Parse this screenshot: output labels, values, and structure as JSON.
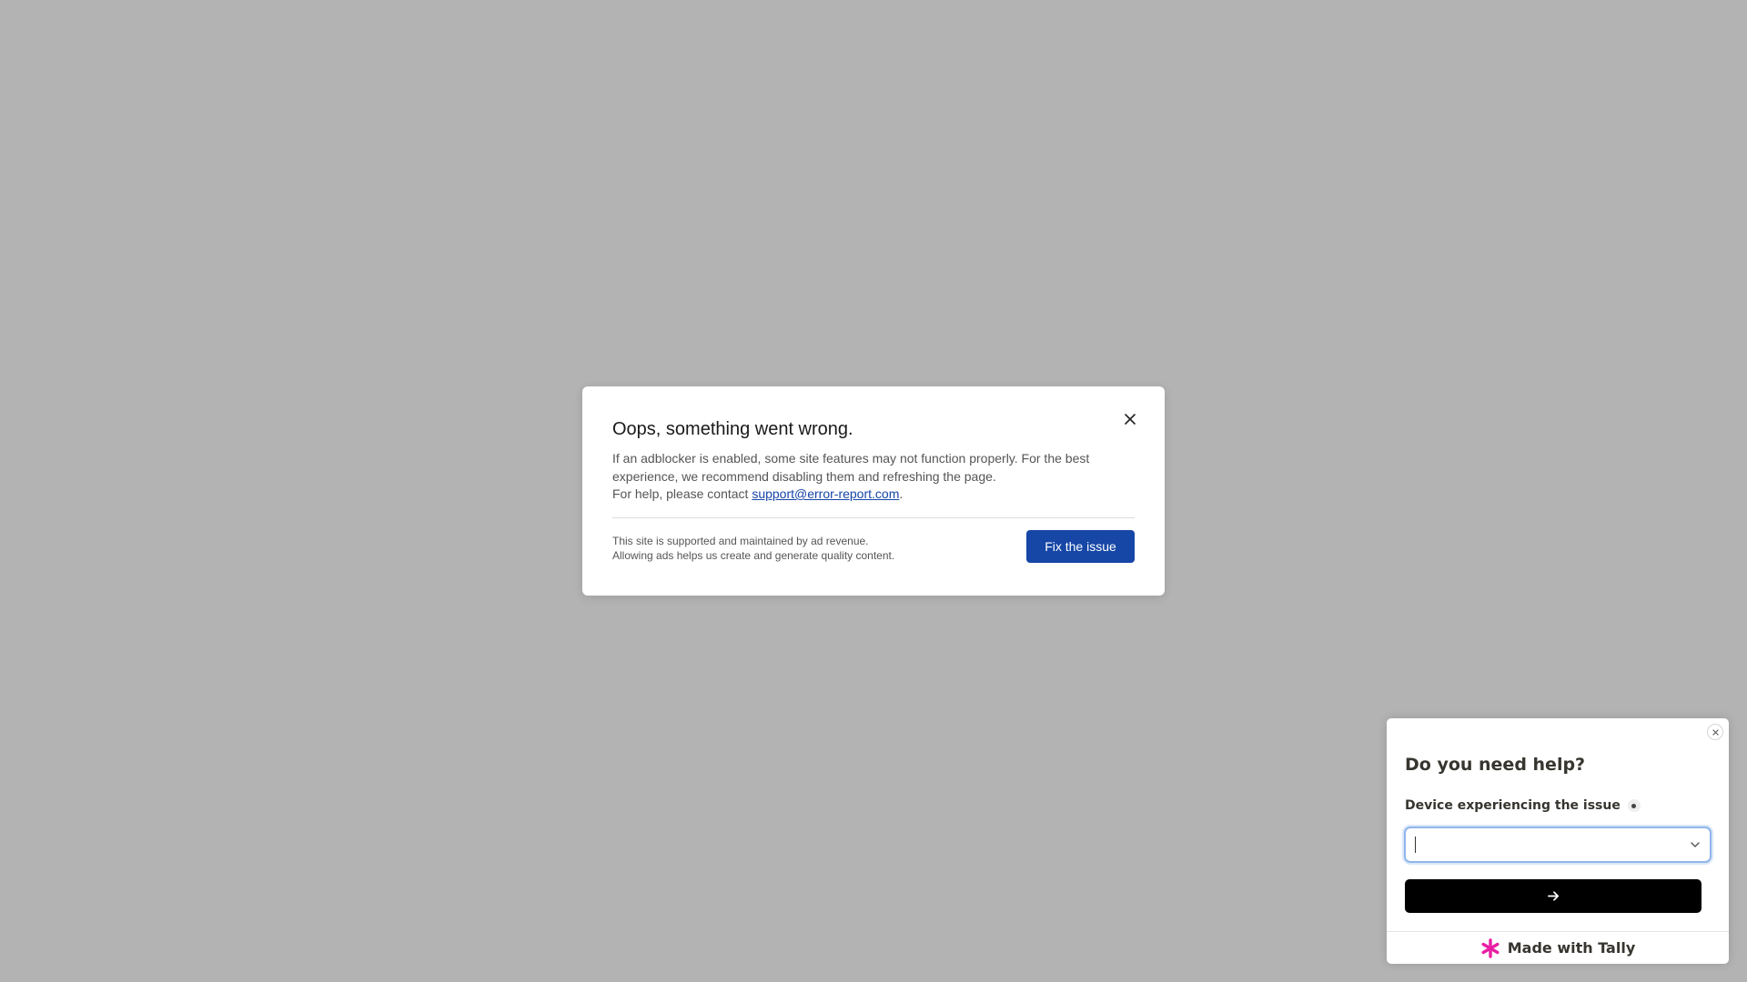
{
  "modal": {
    "title": "Oops, something went wrong.",
    "body_line1": "If an adblocker is enabled, some site features may not function properly. For the best experience, we recommend disabling them and refreshing the page.",
    "body_help_prefix": "For help, please contact ",
    "support_email": "support@error-report.com",
    "body_help_suffix": ".",
    "footer_line1": "This site is supported and maintained by ad revenue.",
    "footer_line2": "Allowing ads helps us create and generate quality content.",
    "fix_button": "Fix the issue",
    "close_icon": "close-icon"
  },
  "tally": {
    "title": "Do you need help?",
    "field_label": "Device experiencing the issue",
    "field_value": "",
    "footer_text": "Made with Tally",
    "colors": {
      "brand": "#e91ea3",
      "submit_bg": "#000000",
      "focus_border": "#8fb6ea"
    },
    "icons": [
      "close-icon",
      "chevron-down-icon",
      "arrow-right-icon",
      "tally-asterisk-icon"
    ]
  },
  "colors": {
    "overlay": "#b3b3b3",
    "primary_button": "#1646a6"
  }
}
